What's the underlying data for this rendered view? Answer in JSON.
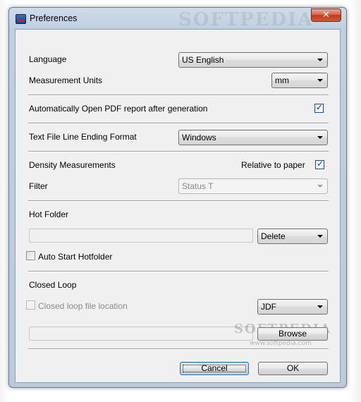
{
  "window": {
    "title": "Preferences",
    "close_glyph": "✕"
  },
  "language": {
    "label": "Language",
    "value": "US English"
  },
  "units": {
    "label": "Measurement Units",
    "value": "mm"
  },
  "auto_open": {
    "label": "Automatically Open PDF report after generation",
    "checked": true
  },
  "line_ending": {
    "label": "Text File Line Ending Format",
    "value": "Windows"
  },
  "density": {
    "label": "Density Measurements",
    "relative_label": "Relative to paper",
    "relative_checked": true
  },
  "filter": {
    "label": "Filter",
    "value": "Status T"
  },
  "hot_folder": {
    "label": "Hot Folder",
    "path_value": "",
    "action_value": "Delete",
    "auto_start_label": "Auto Start Hotfolder",
    "auto_start_checked": false
  },
  "closed_loop": {
    "label": "Closed Loop",
    "location_label": "Closed loop file location",
    "location_checked": false,
    "format_value": "JDF",
    "path_value": "",
    "browse_label": "Browse"
  },
  "buttons": {
    "cancel": "Cancel",
    "ok": "OK"
  },
  "check_glyph": "✓",
  "watermark": {
    "main": "SOFTPEDIA",
    "url": "www.softpedia.com"
  },
  "colors": {
    "titlebar": "#c0cfdf",
    "close": "#c3391f",
    "client": "#f0f0f0"
  }
}
